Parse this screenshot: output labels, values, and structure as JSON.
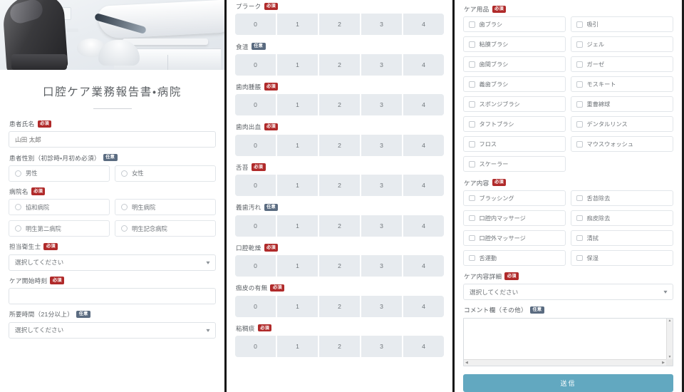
{
  "form": {
    "title": "口腔ケア業務報告書・病院",
    "badges": {
      "required": "必須",
      "optional": "任意"
    },
    "colors": {
      "badge_required": "#b02a2a",
      "badge_optional": "#5a6b80",
      "submit_button": "#62a8c0",
      "scale_cell": "#e7ebef",
      "page_background": "#ffffff"
    }
  },
  "left": {
    "hero_image": "dental-clinic-photo",
    "patient_name": {
      "label": "患者氏名",
      "badge": "必須",
      "placeholder": "山田 太郎",
      "value": ""
    },
    "patient_gender": {
      "label": "患者性別（初診時・月初め必須）",
      "badge": "任意",
      "options": [
        "男性",
        "女性"
      ]
    },
    "hospital_name": {
      "label": "病院名",
      "badge": "必須",
      "options": [
        "協和病院",
        "明生病院",
        "明生第二病院",
        "明生記念病院"
      ]
    },
    "hygienist": {
      "label": "担当衛生士",
      "badge": "必須",
      "value": "選択してください"
    },
    "care_start_time": {
      "label": "ケア開始時刻",
      "badge": "必須",
      "value": ""
    },
    "duration": {
      "label": "所要時間（21分以上）",
      "badge": "任意",
      "value": "選択してください"
    }
  },
  "middle": {
    "scale_values": [
      "0",
      "1",
      "2",
      "3",
      "4"
    ],
    "items": [
      {
        "label": "プラーク",
        "badge": "必須"
      },
      {
        "label": "食渣",
        "badge": "任意"
      },
      {
        "label": "歯肉腫脹",
        "badge": "必須"
      },
      {
        "label": "歯肉出血",
        "badge": "必須"
      },
      {
        "label": "舌苔",
        "badge": "必須"
      },
      {
        "label": "義歯汚れ",
        "badge": "任意"
      },
      {
        "label": "口腔乾燥",
        "badge": "必須"
      },
      {
        "label": "痂皮の有無",
        "badge": "必須"
      },
      {
        "label": "粘稠痰",
        "badge": "必須"
      }
    ]
  },
  "right": {
    "care_supplies": {
      "label": "ケア用品",
      "badge": "必須",
      "options": [
        "歯ブラシ",
        "吸引",
        "粘膜ブラシ",
        "ジェル",
        "歯間ブラシ",
        "ガーゼ",
        "義歯ブラシ",
        "モスキート",
        "スポンジブラシ",
        "重曹綿球",
        "タフトブラシ",
        "デンタルリンス",
        "フロス",
        "マウスウォッシュ",
        "スケーラー"
      ]
    },
    "care_content": {
      "label": "ケア内容",
      "badge": "必須",
      "options": [
        "ブラッシング",
        "舌苔除去",
        "口腔内マッサージ",
        "痂皮除去",
        "口腔外マッサージ",
        "清拭",
        "舌運動",
        "保湿"
      ]
    },
    "care_detail": {
      "label": "ケア内容詳細",
      "badge": "必須",
      "value": "選択してください"
    },
    "comment": {
      "label": "コメント欄（その他）",
      "badge": "任意",
      "value": ""
    },
    "submit_label": "送信"
  }
}
